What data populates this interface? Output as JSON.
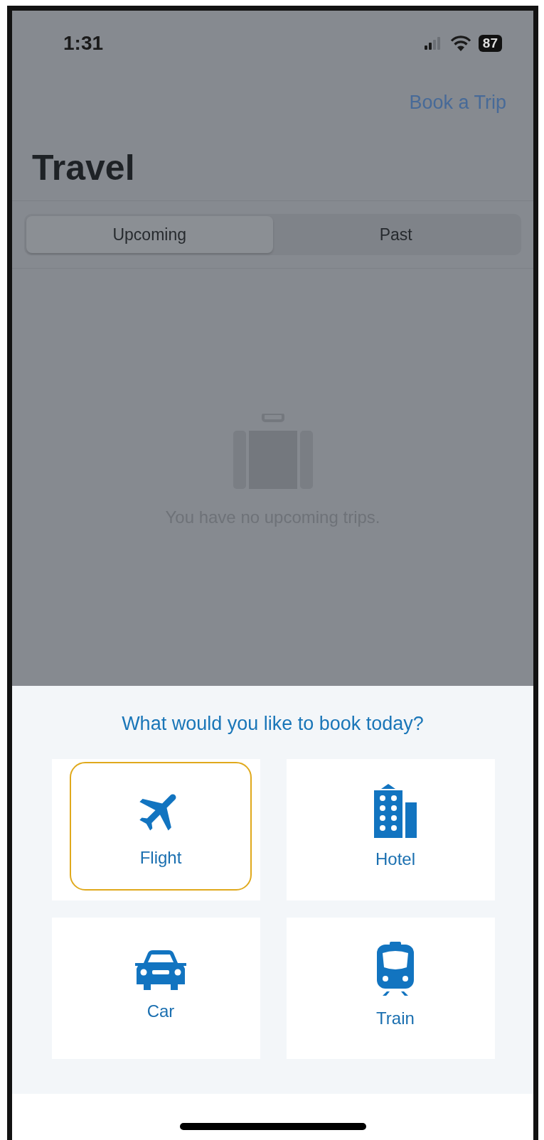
{
  "status_bar": {
    "time": "1:31",
    "battery": "87"
  },
  "nav": {
    "action": "Book a Trip",
    "title": "Travel"
  },
  "tabs": [
    {
      "label": "Upcoming",
      "selected": true
    },
    {
      "label": "Past",
      "selected": false
    }
  ],
  "empty_state": {
    "message": "You have no upcoming trips."
  },
  "booking_sheet": {
    "prompt": "What would you like to book today?",
    "options": [
      {
        "kind": "flight",
        "label": "Flight",
        "selected": true
      },
      {
        "kind": "hotel",
        "label": "Hotel",
        "selected": false
      },
      {
        "kind": "car",
        "label": "Car",
        "selected": false
      },
      {
        "kind": "train",
        "label": "Train",
        "selected": false
      }
    ]
  }
}
